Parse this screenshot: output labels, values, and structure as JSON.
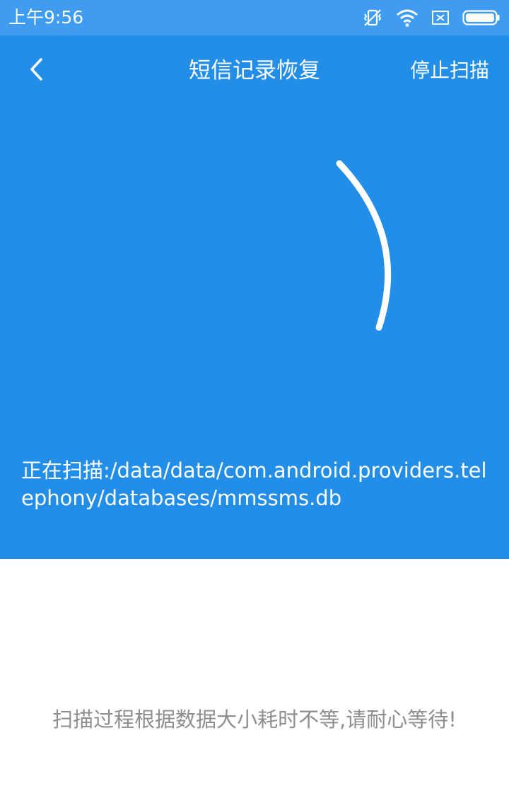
{
  "status_bar": {
    "time": "上午9:56",
    "icons": [
      "vibrate-off-icon",
      "wifi-icon",
      "sim-none-icon",
      "battery-icon"
    ]
  },
  "header": {
    "back_icon": "chevron-left-icon",
    "title": "短信记录恢复",
    "stop_label": "停止扫描"
  },
  "scan": {
    "spinner_icon": "loading-arc-icon",
    "label": "正在扫描:",
    "path": "/data/data/com.android.providers.telephony/databases/mmssms.db"
  },
  "hint": "扫描过程根据数据大小耗时不等,请耐心等待!",
  "colors": {
    "status_bar": "#3f9cf0",
    "panel": "#238ee7",
    "hint_text": "#8e8e8e"
  }
}
